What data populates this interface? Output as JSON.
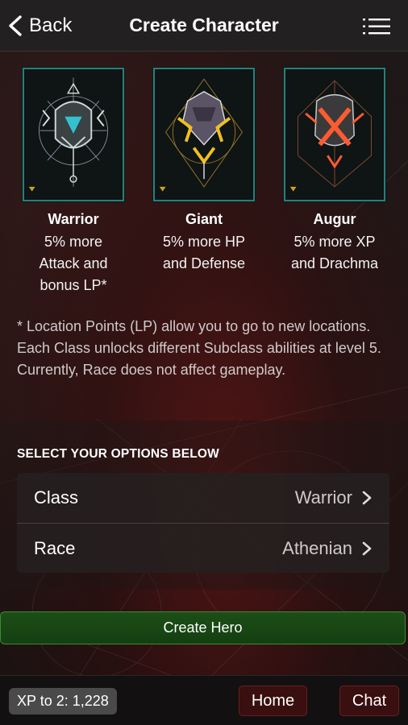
{
  "header": {
    "back_label": "Back",
    "title": "Create Character",
    "back_icon": "chevron-left-icon",
    "menu_icon": "list-menu-icon"
  },
  "classes": [
    {
      "name": "Warrior",
      "line1": "5% more",
      "line2": "Attack and",
      "line3": "bonus LP*",
      "accent": "#3fa9b0"
    },
    {
      "name": "Giant",
      "line1": "5% more HP",
      "line2": "and Defense",
      "line3": "",
      "accent": "#e0b020"
    },
    {
      "name": "Augur",
      "line1": "5% more XP",
      "line2": "and Drachma",
      "line3": "",
      "accent": "#e05030"
    }
  ],
  "note": "* Location Points (LP) allow you to go to new locations. Each Class unlocks different Subclass abilities at level 5. Currently, Race does not affect gameplay.",
  "options": {
    "title": "SELECT YOUR OPTIONS BELOW",
    "rows": [
      {
        "label": "Class",
        "value": "Warrior"
      },
      {
        "label": "Race",
        "value": "Athenian"
      }
    ]
  },
  "create_button": "Create Hero",
  "footer": {
    "xp": "XP to 2: 1,228",
    "home": "Home",
    "chat": "Chat"
  },
  "colors": {
    "portrait_border": "#27807a",
    "create_button_bg": "#1c4e17",
    "footer_button_bg": "#3a0f0f"
  }
}
